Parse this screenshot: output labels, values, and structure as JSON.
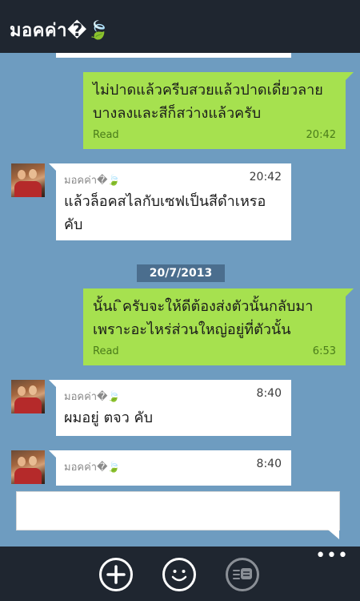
{
  "header": {
    "title": "มอคค่า�🍃"
  },
  "messages": {
    "m1": {
      "text_line1": "ไม่ปาดแล้วครีบสวยแล้วปาดเดี่ยวลาย",
      "text_line2": "บางลงและสีก็สว่างแล้วครับ",
      "status": "Read",
      "time": "20:42"
    },
    "m2": {
      "sender": "มอคค่า�🍃",
      "text_line1": "แล้วล็อคสไลกับเซฟเป็นสีดำเหรอ",
      "text_line2": "คับ",
      "time": "20:42"
    },
    "date_separator": "20/7/2013",
    "m3": {
      "text_line1": "นั้นเ ิครับจะให้ดีต้องส่งตัวนั้นกลับมา",
      "text_line2": "เพราะอะไหร่ส่วนใหญ่อยู่ที่ตัวนั้น",
      "status": "Read",
      "time": "6:53"
    },
    "m4": {
      "sender": "มอคค่า�🍃",
      "text_line1": "ผมอยู่ ตจว คับ",
      "time": "8:40"
    },
    "m5": {
      "sender": "มอคค่า�🍃",
      "time": "8:40"
    }
  },
  "compose": {
    "placeholder": ""
  },
  "appbar": {
    "add_icon": "plus-circle-icon",
    "emoji_icon": "smiley-icon",
    "sticker_icon": "message-list-icon",
    "more_label": "•••"
  }
}
